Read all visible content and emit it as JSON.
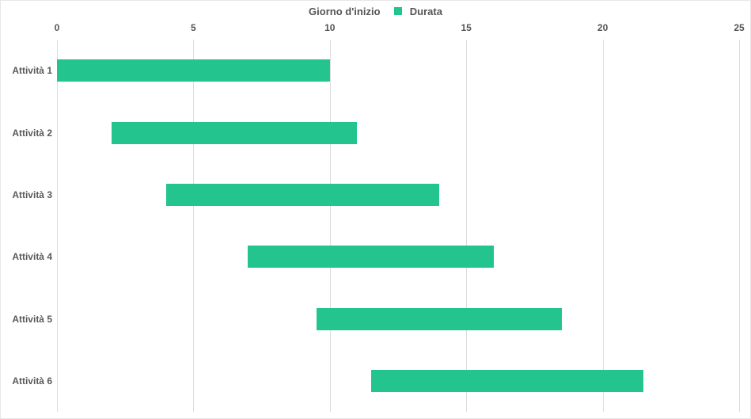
{
  "legend": {
    "inizio_label": "Giorno d'inizio",
    "durata_label": "Durata",
    "swatch_color": "#23C48E"
  },
  "axis": {
    "x_min": 0,
    "x_max": 25,
    "x_ticks": [
      0,
      5,
      10,
      15,
      20,
      25
    ]
  },
  "categories": [
    "Attività 1",
    "Attività 2",
    "Attività 3",
    "Attività 4",
    "Attività 5",
    "Attività 6"
  ],
  "chart_data": {
    "type": "bar",
    "orientation": "horizontal",
    "stacked": true,
    "title": "",
    "xlabel": "",
    "ylabel": "",
    "xlim": [
      0,
      25
    ],
    "x_ticks": [
      0,
      5,
      10,
      15,
      20,
      25
    ],
    "categories": [
      "Attività 1",
      "Attività 2",
      "Attività 3",
      "Attività 4",
      "Attività 5",
      "Attività 6"
    ],
    "series": [
      {
        "name": "Giorno d'inizio",
        "values": [
          0,
          2,
          4,
          7,
          9.5,
          11.5
        ],
        "color": "transparent"
      },
      {
        "name": "Durata",
        "values": [
          10,
          9,
          10,
          9,
          9,
          10
        ],
        "color": "#23C48E"
      }
    ],
    "legend_position": "top"
  }
}
